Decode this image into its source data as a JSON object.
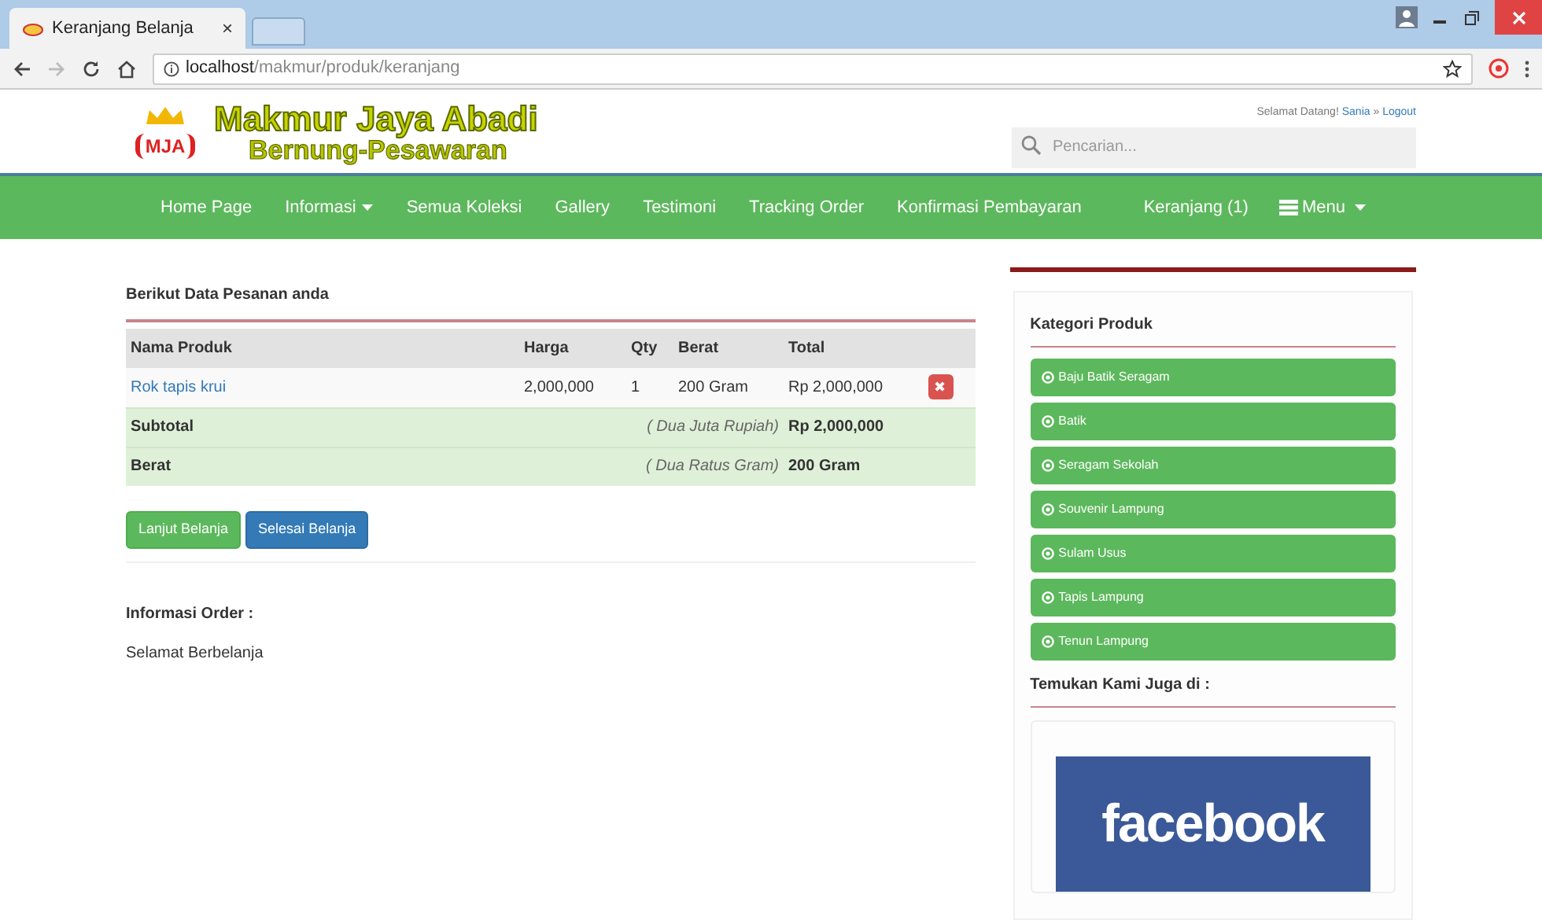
{
  "browser": {
    "tab_title": "Keranjang Belanja",
    "tab_close": "×",
    "url_host": "localhost",
    "url_path": "/makmur/produk/keranjang"
  },
  "header": {
    "logo_badge": "MJA",
    "title": "Makmur Jaya Abadi",
    "subtitle": "Bernung-Pesawaran",
    "greeting": "Selamat Datang!",
    "user": "Sania",
    "separator": "»",
    "logout": "Logout",
    "search": {
      "placeholder": "Pencarian..."
    }
  },
  "nav": {
    "items": [
      {
        "label": "Home Page",
        "dropdown": false
      },
      {
        "label": "Informasi",
        "dropdown": true
      },
      {
        "label": "Semua Koleksi",
        "dropdown": false
      },
      {
        "label": "Gallery",
        "dropdown": false
      },
      {
        "label": "Testimoni",
        "dropdown": false
      },
      {
        "label": "Tracking Order",
        "dropdown": false
      },
      {
        "label": "Konfirmasi Pembayaran",
        "dropdown": false
      }
    ],
    "right": [
      {
        "label": "Keranjang (1)",
        "dropdown": false,
        "icon": false
      },
      {
        "label": "Menu",
        "dropdown": true,
        "icon": true
      }
    ]
  },
  "order": {
    "heading": "Berikut Data Pesanan anda",
    "columns": [
      "Nama Produk",
      "Harga",
      "Qty",
      "Berat",
      "Total"
    ],
    "rows": [
      {
        "name": "Rok tapis krui",
        "price": "2,000,000",
        "qty": "1",
        "weight": "200 Gram",
        "total": "Rp 2,000,000",
        "delete": "✖"
      }
    ],
    "summary": [
      {
        "label": "Subtotal",
        "words": "( Dua Juta Rupiah)",
        "value": "Rp 2,000,000"
      },
      {
        "label": "Berat",
        "words": "( Dua Ratus Gram)",
        "value": "200 Gram"
      }
    ],
    "buttons": [
      {
        "label": "Lanjut Belanja",
        "kind": "success"
      },
      {
        "label": "Selesai Belanja",
        "kind": "primary"
      }
    ],
    "info_heading": "Informasi Order :",
    "info_text": "Selamat Berbelanja"
  },
  "sidebar": {
    "categories_title": "Kategori Produk",
    "categories": [
      "Baju Batik Seragam",
      "Batik",
      "Seragam Sekolah",
      "Souvenir Lampung",
      "Sulam Usus",
      "Tapis Lampung",
      "Tenun Lampung"
    ],
    "social_title": "Temukan Kami Juga di :",
    "social_logo": "facebook"
  }
}
